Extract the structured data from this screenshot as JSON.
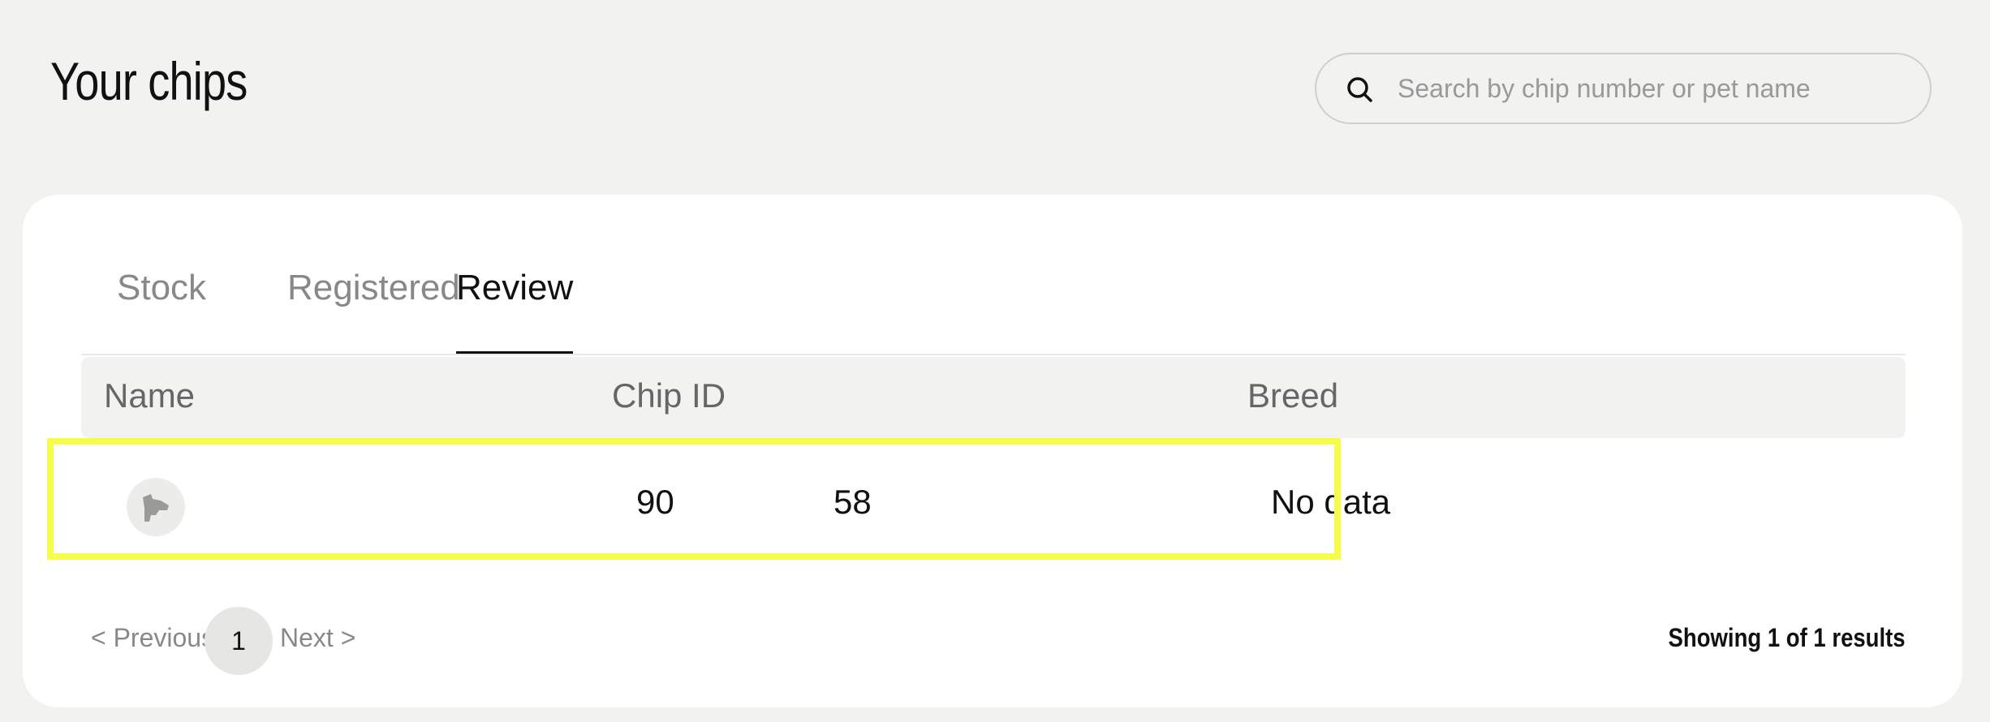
{
  "page_title": "Your chips",
  "search": {
    "placeholder": "Search by chip number or pet name",
    "value": ""
  },
  "tabs": [
    {
      "label": "Stock",
      "active": false
    },
    {
      "label": "Registered",
      "active": false
    },
    {
      "label": "Review",
      "active": true
    }
  ],
  "table": {
    "columns": [
      "Name",
      "Chip ID",
      "Breed"
    ],
    "rows": [
      {
        "name": "",
        "avatar_icon": "dog-head-icon",
        "chip_id_start": "90",
        "chip_id_end": "58",
        "breed": "No data"
      }
    ]
  },
  "pagination": {
    "previous_label": "< Previous",
    "current_page": "1",
    "next_label": "Next >"
  },
  "results_label": "Showing 1 of 1 results",
  "colors": {
    "background": "#f2f2f1",
    "card": "#ffffff",
    "highlight": "#f7fb4a",
    "muted_text": "#888888",
    "text": "#111111"
  }
}
